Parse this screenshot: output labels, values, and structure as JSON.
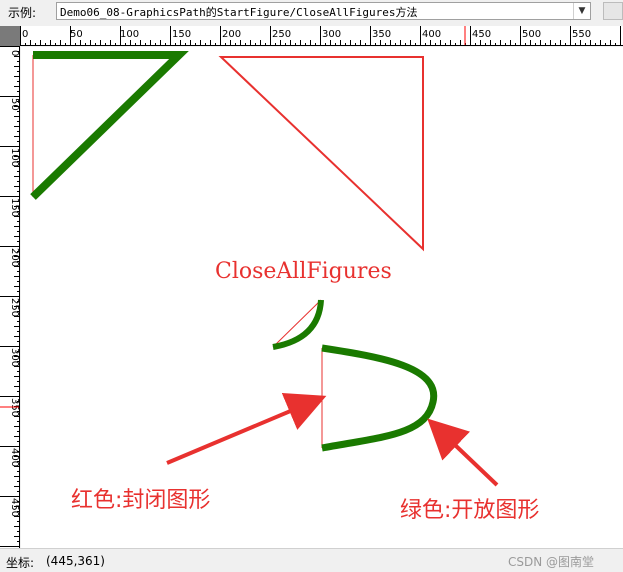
{
  "toolbar": {
    "label": "示例:",
    "selected_example": "Demo06_08-GraphicsPath的StartFigure/CloseAllFigures方法",
    "dropdown_icon": "chevron-down-icon"
  },
  "ruler": {
    "top_labels": [
      "0",
      "50",
      "100",
      "150",
      "200",
      "250",
      "300",
      "350",
      "400",
      "450",
      "500",
      "550"
    ],
    "left_labels": [
      "0",
      "50",
      "100",
      "150",
      "200",
      "250",
      "300",
      "350",
      "400",
      "450"
    ]
  },
  "canvas": {
    "caption": "CloseAllFigures",
    "red_note": "红色:封闭图形",
    "green_note": "绿色:开放图形",
    "colors": {
      "red": "#e8312f",
      "green": "#1a7a00",
      "marker": "#ff0000"
    }
  },
  "statusbar": {
    "label": "坐标:",
    "coordinates": "(445,361)",
    "watermark": "CSDN @图南堂"
  }
}
